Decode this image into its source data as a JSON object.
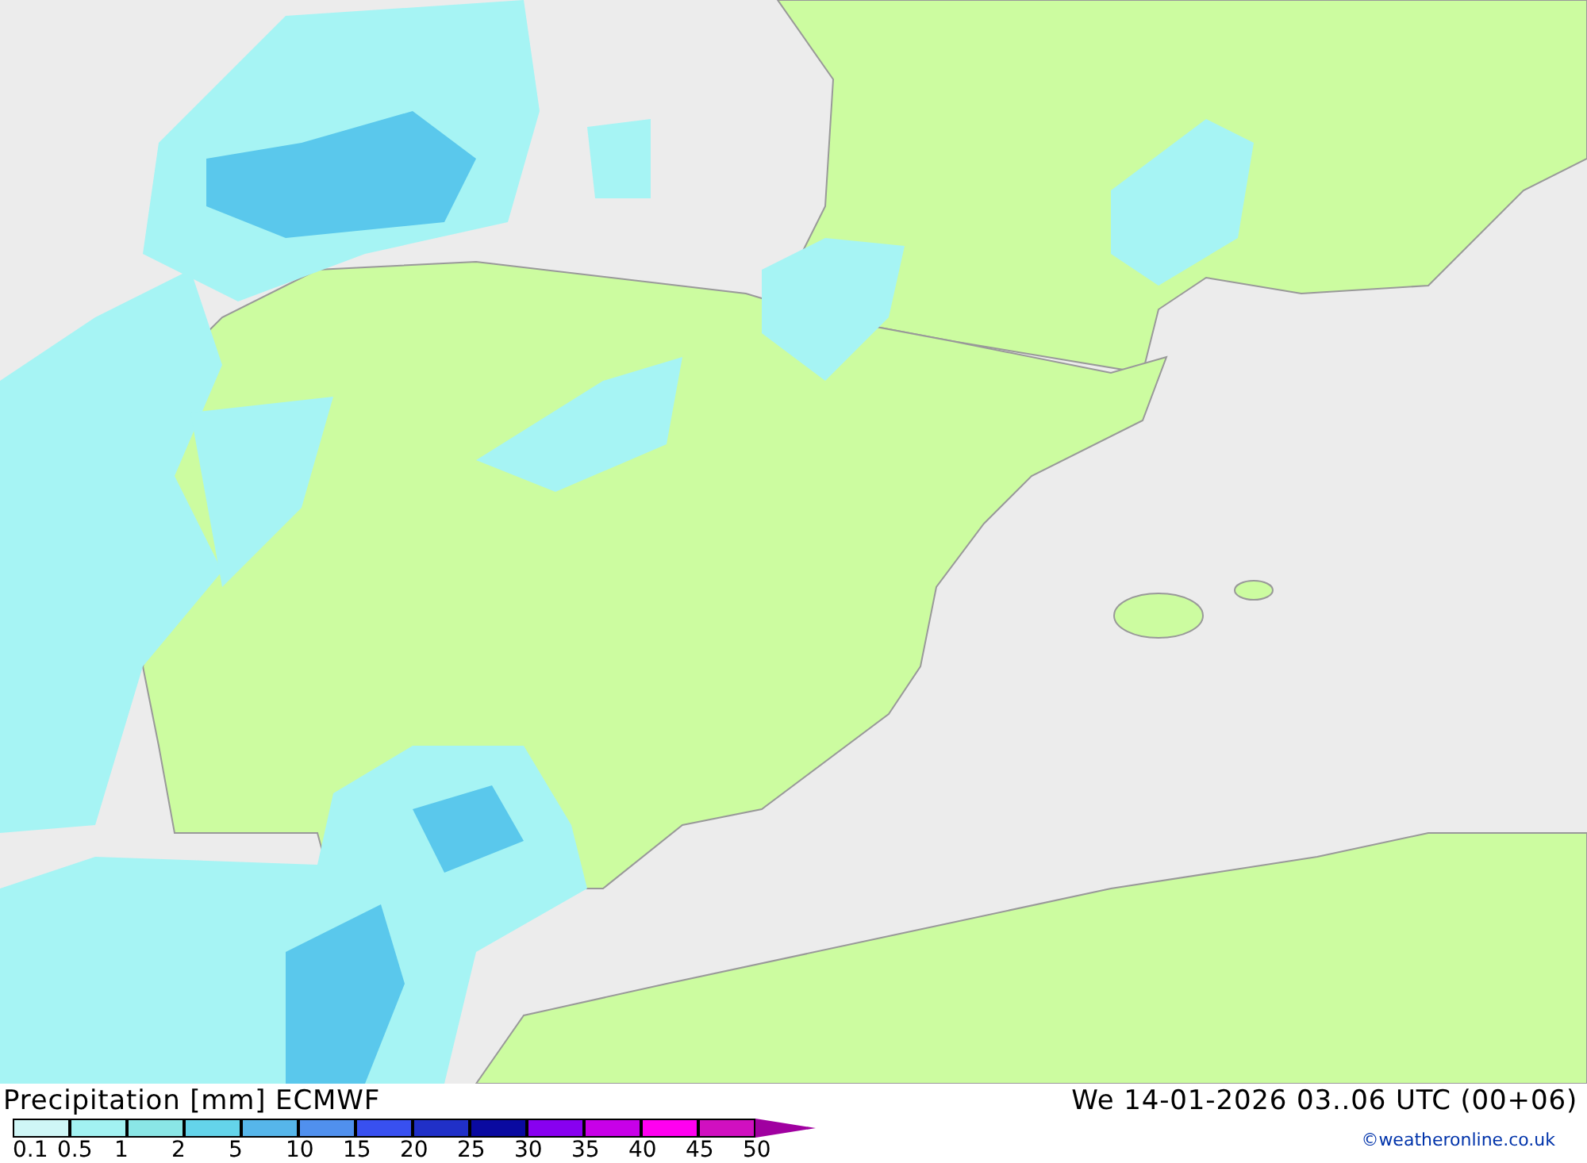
{
  "map": {
    "kind": "precipitation"
  },
  "title": "Precipitation [mm]",
  "model": "ECMWF",
  "valid_time": "We 14-01-2026 03..06 UTC (00+06)",
  "legend": {
    "labels": [
      "0.1",
      "0.5",
      "1",
      "2",
      "5",
      "10",
      "15",
      "20",
      "25",
      "30",
      "35",
      "40",
      "45",
      "50"
    ],
    "bins": [
      {
        "color": "#cff6f6"
      },
      {
        "color": "#a2f2f2"
      },
      {
        "color": "#8ae6e6"
      },
      {
        "color": "#64d4ea"
      },
      {
        "color": "#56b6ea"
      },
      {
        "color": "#5090ee"
      },
      {
        "color": "#3850f0"
      },
      {
        "color": "#2030c8"
      },
      {
        "color": "#0a0aa0"
      },
      {
        "color": "#8800f0"
      },
      {
        "color": "#c800e8"
      },
      {
        "color": "#ff00f0"
      },
      {
        "color": "#d010c0"
      },
      {
        "kind": "overflow",
        "color": "#a000a0"
      }
    ]
  },
  "credit": "©weatheronline.co.uk"
}
